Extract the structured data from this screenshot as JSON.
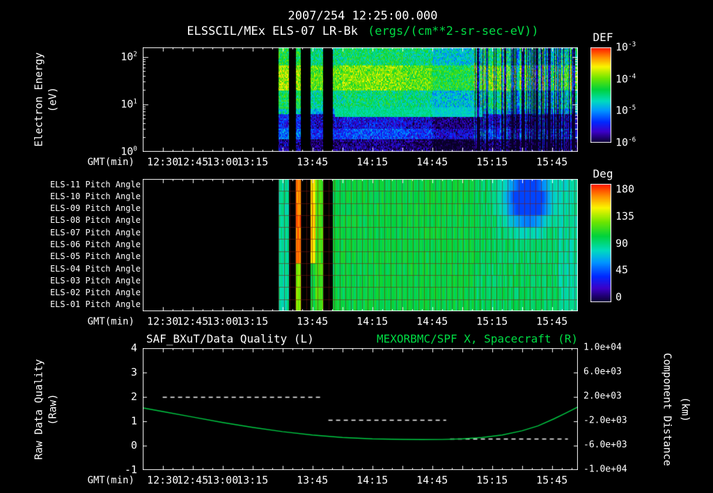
{
  "header": {
    "title_datetime": "2007/254 12:25:00.000",
    "title_instrument": "ELSSCIL/MEx ELS-07 LR-Bk",
    "title_units": "(ergs/(cm**2-sr-sec-eV))",
    "units_color": "#00dd44"
  },
  "axes": {
    "time": {
      "label": "GMT(min)",
      "range_minutes_after_1200": [
        20,
        238
      ],
      "ticks": [
        {
          "t": 30,
          "label": "12:30"
        },
        {
          "t": 45,
          "label": "12:45"
        },
        {
          "t": 60,
          "label": "13:00"
        },
        {
          "t": 75,
          "label": "13:15"
        },
        {
          "t": 105,
          "label": "13:45"
        },
        {
          "t": 135,
          "label": "14:15"
        },
        {
          "t": 165,
          "label": "14:45"
        },
        {
          "t": 195,
          "label": "15:15"
        },
        {
          "t": 225,
          "label": "15:45"
        }
      ]
    }
  },
  "panel_energy": {
    "ylabel_line1": "Electron Energy",
    "ylabel_line2": "(eV)",
    "yticks": [
      {
        "mantissa": "10",
        "exp": "2",
        "value": 100
      },
      {
        "mantissa": "10",
        "exp": "1",
        "value": 10
      },
      {
        "mantissa": "10",
        "exp": "0",
        "value": 1
      }
    ],
    "colorbar": {
      "title": "DEF",
      "ticks": [
        {
          "mantissa": "10",
          "exp": "-3"
        },
        {
          "mantissa": "10",
          "exp": "-4"
        },
        {
          "mantissa": "10",
          "exp": "-5"
        },
        {
          "mantissa": "10",
          "exp": "-6"
        }
      ]
    }
  },
  "panel_pitch": {
    "row_labels": [
      "ELS-11 Pitch Angle",
      "ELS-10 Pitch Angle",
      "ELS-09 Pitch Angle",
      "ELS-08 Pitch Angle",
      "ELS-07 Pitch Angle",
      "ELS-06 Pitch Angle",
      "ELS-05 Pitch Angle",
      "ELS-04 Pitch Angle",
      "ELS-03 Pitch Angle",
      "ELS-02 Pitch Angle",
      "ELS-01 Pitch Angle"
    ],
    "colorbar": {
      "title": "Deg",
      "ticks": [
        "180",
        "135",
        "90",
        "45",
        "0"
      ]
    }
  },
  "panel_line": {
    "title_left": "SAF_BXuT/Data Quality (L)",
    "title_right": "MEXORBMC/SPF X, Spacecraft (R)",
    "ylabel_line1": "Raw Data Quality",
    "ylabel_line2": "(Raw)",
    "left_ticks": [
      "4",
      "3",
      "2",
      "1",
      "0",
      "-1"
    ],
    "right_label_line1": "Component Distance",
    "right_label_line2": "(km)",
    "right_ticks": [
      "1.0e+04",
      "6.0e+03",
      "2.0e+03",
      "-2.0e+03",
      "-6.0e+03",
      "-1.0e+04"
    ]
  },
  "chart_data": [
    {
      "id": "electron_energy_spectrogram",
      "type": "heatmap",
      "title": "ELSSCIL/MEx ELS-07 LR-Bk",
      "units": "ergs/(cm**2-sr-sec-eV)",
      "xlabel": "GMT(min)",
      "xlim_minutes_after_1200": [
        20,
        238
      ],
      "ylabel": "Electron Energy (eV)",
      "yscale": "log",
      "ylim_ev": [
        1,
        158
      ],
      "colorbar_label": "DEF",
      "value": "log10 differential energy flux",
      "vlim": [
        -6,
        -3
      ],
      "data_start_minute": 88,
      "data_gaps_minutes": [
        [
          93,
          96.5
        ],
        [
          99,
          104
        ],
        [
          110,
          115
        ]
      ],
      "energy_bands": [
        {
          "e_lo": 64,
          "e_hi": 158,
          "log10_def": -4.5
        },
        {
          "e_lo": 19,
          "e_hi": 64,
          "log10_def": -4.05
        },
        {
          "e_lo": 8,
          "e_hi": 19,
          "log10_def": -4.55
        },
        {
          "e_lo": 6,
          "e_hi": 8,
          "log10_def": -4.85
        },
        {
          "e_lo": 3,
          "e_hi": 6,
          "log10_def": -5.6
        },
        {
          "e_lo": 1.8,
          "e_hi": 3,
          "log10_def": -5.35
        },
        {
          "e_lo": 1.0,
          "e_hi": 1.8,
          "log10_def": -5.9
        }
      ],
      "overlays": [
        {
          "e_lo": 5.5,
          "e_hi": 8.5,
          "t": [
            116,
            190
          ],
          "log10_def": -4.55
        }
      ],
      "time_modulation": [
        {
          "t": [
            88,
            104
          ],
          "delta": 0.2
        },
        {
          "t": [
            120,
            150
          ],
          "delta": 0.1
        },
        {
          "t": [
            165,
            186
          ],
          "delta": -0.25
        }
      ],
      "stripes_from_minute": 186
    },
    {
      "id": "pitch_angle_heatmap",
      "type": "heatmap",
      "rows": [
        "ELS-11",
        "ELS-10",
        "ELS-09",
        "ELS-08",
        "ELS-07",
        "ELS-06",
        "ELS-05",
        "ELS-04",
        "ELS-03",
        "ELS-02",
        "ELS-01"
      ],
      "value_units": "degrees",
      "vlim": [
        0,
        180
      ],
      "colorbar_label": "Deg",
      "data_start_minute": 88,
      "data_gaps_minutes": [
        [
          93,
          96.5
        ],
        [
          99,
          104
        ],
        [
          110,
          115
        ]
      ],
      "base_deg": 100,
      "features": [
        {
          "t": [
            88,
            93
          ],
          "rows": [
            0,
            10
          ],
          "deg": 85
        },
        {
          "t": [
            96.5,
            99
          ],
          "rows": [
            0,
            6
          ],
          "deg": 165
        },
        {
          "t": [
            96.5,
            99
          ],
          "rows": [
            7,
            10
          ],
          "deg": 125
        },
        {
          "t": [
            104,
            106.5
          ],
          "rows": [
            0,
            6
          ],
          "deg": 150
        },
        {
          "t": [
            106.5,
            110
          ],
          "rows": [
            0,
            10
          ],
          "deg": 115
        },
        {
          "t": [
            186,
            228
          ],
          "rows": [
            0,
            10
          ],
          "deg": 95
        },
        {
          "t": [
            228,
            238
          ],
          "rows": [
            0,
            10
          ],
          "deg": 85
        }
      ],
      "blob": {
        "t_center": 213,
        "t_sigma": 11,
        "row_center": 1.2,
        "row_sigma": 2.2,
        "deg": 45
      }
    },
    {
      "id": "data_quality_and_spacecraft_x",
      "type": "line",
      "title_left": "SAF_BXuT/Data Quality (L)",
      "title_right": "MEXORBMC/SPF X, Spacecraft (R)",
      "left_axis": {
        "label": "Raw Data Quality (Raw)",
        "lim": [
          -1,
          4
        ],
        "ticks": [
          4,
          3,
          2,
          1,
          0,
          -1
        ]
      },
      "right_axis": {
        "label": "Component Distance (km)",
        "lim": [
          -10000,
          10000
        ],
        "ticks": [
          10000,
          6000,
          2000,
          -2000,
          -6000,
          -10000
        ]
      },
      "series": [
        {
          "name": "SAF_BXuT/Data Quality (L)",
          "axis": "left",
          "style": "dashed",
          "color": "#ffffff",
          "segments": [
            {
              "t": [
                30,
                110
              ],
              "value": 2
            },
            {
              "t": [
                113,
                172
              ],
              "value": 1.05
            },
            {
              "t": [
                174,
                233
              ],
              "value": 0.3
            }
          ]
        },
        {
          "name": "MEXORBMC/SPF X, Spacecraft (R)",
          "axis": "right",
          "style": "solid",
          "color": "#00cc44",
          "t": [
            20,
            30,
            45,
            60,
            75,
            90,
            105,
            120,
            135,
            150,
            160,
            170,
            180,
            190,
            200,
            210,
            218,
            226,
            232,
            238
          ],
          "km": [
            200,
            -400,
            -1300,
            -2200,
            -3000,
            -3700,
            -4250,
            -4650,
            -4880,
            -4975,
            -5000,
            -4980,
            -4880,
            -4650,
            -4250,
            -3550,
            -2750,
            -1600,
            -650,
            350
          ]
        }
      ]
    }
  ]
}
